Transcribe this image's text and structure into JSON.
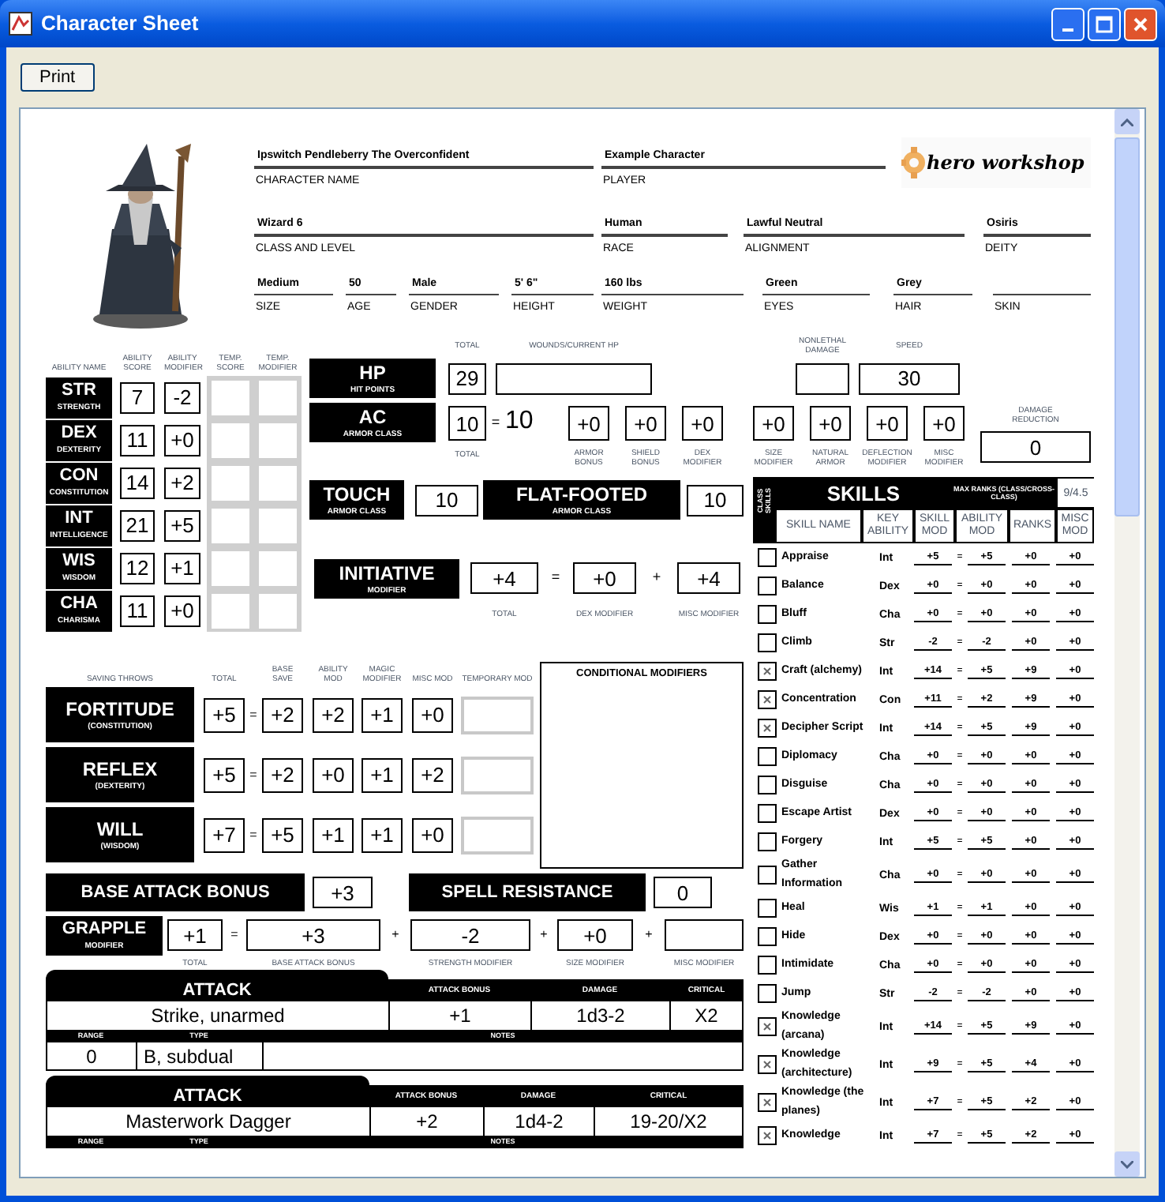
{
  "window": {
    "title": "Character Sheet"
  },
  "toolbar": {
    "buttons": [
      "Print"
    ]
  },
  "header": {
    "logo": "hero workshop",
    "fields": [
      {
        "value": "Ipswitch Pendleberry The Overconfident",
        "label": "CHARACTER NAME"
      },
      {
        "value": "Example Character",
        "label": "PLAYER"
      },
      {
        "value": "Wizard 6",
        "label": "CLASS AND LEVEL"
      },
      {
        "value": "Human",
        "label": "RACE"
      },
      {
        "value": "Lawful Neutral",
        "label": "ALIGNMENT"
      },
      {
        "value": "Osiris",
        "label": "DEITY"
      },
      {
        "value": "Medium",
        "label": "SIZE"
      },
      {
        "value": "50",
        "label": "AGE"
      },
      {
        "value": "Male",
        "label": "GENDER"
      },
      {
        "value": "5' 6\"",
        "label": "HEIGHT"
      },
      {
        "value": "160 lbs",
        "label": "WEIGHT"
      },
      {
        "value": "Green",
        "label": "EYES"
      },
      {
        "value": "Grey",
        "label": "HAIR"
      },
      {
        "label": "SKIN"
      }
    ]
  },
  "abilities": {
    "headers": [
      "ABILITY NAME",
      "ABILITY SCORE",
      "ABILITY MODIFIER",
      "TEMP. SCORE",
      "TEMP. MODIFIER"
    ],
    "rows": [
      {
        "abbr": "STR",
        "name": "STRENGTH",
        "score": "7",
        "modifier": "-2"
      },
      {
        "abbr": "DEX",
        "name": "DEXTERITY",
        "score": "11",
        "modifier": "+0"
      },
      {
        "abbr": "CON",
        "name": "CONSTITUTION",
        "score": "14",
        "modifier": "+2"
      },
      {
        "abbr": "INT",
        "name": "INTELLIGENCE",
        "score": "21",
        "modifier": "+5"
      },
      {
        "abbr": "WIS",
        "name": "WISDOM",
        "score": "12",
        "modifier": "+1"
      },
      {
        "abbr": "CHA",
        "name": "CHARISMA",
        "score": "11",
        "modifier": "+0"
      }
    ]
  },
  "hp": {
    "label": "HP",
    "sublabel": "HIT POINTS",
    "total_label": "TOTAL",
    "total": "29",
    "wounds_label": "WOUNDS/CURRENT HP",
    "nonlethal_label": "NONLETHAL DAMAGE",
    "speed_label": "SPEED",
    "speed": "30"
  },
  "ac": {
    "label": "AC",
    "sublabel": "ARMOR CLASS",
    "total": "10",
    "total_label": "TOTAL",
    "equals": "=",
    "base": "10",
    "components": [
      {
        "value": "+0",
        "label": "ARMOR BONUS"
      },
      {
        "value": "+0",
        "label": "SHIELD BONUS"
      },
      {
        "value": "+0",
        "label": "DEX MODIFIER"
      },
      {
        "value": "+0",
        "label": "SIZE MODIFIER"
      },
      {
        "value": "+0",
        "label": "NATURAL ARMOR"
      },
      {
        "value": "+0",
        "label": "DEFLECTION MODIFIER"
      },
      {
        "value": "+0",
        "label": "MISC MODIFIER"
      }
    ],
    "damage_reduction": {
      "label": "DAMAGE REDUCTION",
      "value": "0"
    }
  },
  "touch": {
    "label": "TOUCH",
    "sublabel": "ARMOR CLASS",
    "value": "10"
  },
  "flat_footed": {
    "label": "FLAT-FOOTED",
    "sublabel": "ARMOR CLASS",
    "value": "10"
  },
  "initiative": {
    "label": "INITIATIVE",
    "sublabel": "MODIFIER",
    "parts": [
      {
        "value": "+4",
        "label": "TOTAL"
      },
      {
        "op": "=",
        "value": "+0",
        "label": "DEX MODIFIER"
      },
      {
        "op": "+",
        "value": "+4",
        "label": "MISC MODIFIER"
      }
    ]
  },
  "saves": {
    "headers": [
      "SAVING THROWS",
      "TOTAL",
      "BASE SAVE",
      "ABILITY MOD",
      "MAGIC MODIFIER",
      "MISC MOD",
      "TEMPORARY MOD"
    ],
    "rows": [
      {
        "name": "FORTITUDE",
        "ability": "(CONSTITUTION)",
        "equals": "=",
        "values": [
          "+5",
          "+2",
          "+2",
          "+1",
          "+0"
        ]
      },
      {
        "name": "REFLEX",
        "ability": "(DEXTERITY)",
        "equals": "=",
        "values": [
          "+5",
          "+2",
          "+0",
          "+1",
          "+2"
        ]
      },
      {
        "name": "WILL",
        "ability": "(WISDOM)",
        "equals": "=",
        "values": [
          "+7",
          "+5",
          "+1",
          "+1",
          "+0"
        ]
      }
    ]
  },
  "conditional_modifiers": {
    "title": "CONDITIONAL MODIFIERS"
  },
  "base_attack_bonus": {
    "label": "BASE ATTACK BONUS",
    "value": "+3"
  },
  "spell_resistance": {
    "label": "SPELL RESISTANCE",
    "value": "0"
  },
  "grapple": {
    "label": "GRAPPLE",
    "sublabel": "MODIFIER",
    "parts": [
      {
        "value": "+1",
        "label": "TOTAL"
      },
      {
        "op": "=",
        "value": "+3",
        "label": "BASE ATTACK BONUS"
      },
      {
        "op": "+",
        "value": "-2",
        "label": "STRENGTH MODIFIER"
      },
      {
        "op": "+",
        "value": "+0",
        "label": "SIZE MODIFIER"
      },
      {
        "op": "+",
        "label": "MISC MODIFIER"
      }
    ]
  },
  "attacks": [
    {
      "title": "ATTACK",
      "headers": [
        "ATTACK BONUS",
        "DAMAGE",
        "CRITICAL"
      ],
      "name": "Strike, unarmed",
      "bonus": "+1",
      "damage": "1d3-2",
      "critical": "X2",
      "sub_headers": [
        "RANGE",
        "TYPE",
        "NOTES"
      ],
      "range": "0",
      "type": "B, subdual"
    },
    {
      "title": "ATTACK",
      "headers": [
        "ATTACK BONUS",
        "DAMAGE",
        "CRITICAL"
      ],
      "name": "Masterwork Dagger",
      "bonus": "+2",
      "damage": "1d4-2",
      "critical": "19-20/X2",
      "sub_headers": [
        "RANGE",
        "TYPE",
        "NOTES"
      ]
    }
  ],
  "skills": {
    "class_skills_label": "CLASS SKILLS",
    "title": "SKILLS",
    "max_ranks_label": "MAX RANKS (CLASS/CROSS-CLASS)",
    "max_ranks": "9/4.5",
    "columns": [
      "SKILL NAME",
      "KEY ABILITY",
      "SKILL MOD",
      "ABILITY MOD",
      "RANKS",
      "MISC MOD"
    ],
    "rows": [
      {
        "name": "Appraise",
        "class_skill": false,
        "key": "Int",
        "total": "+5",
        "equals": "=",
        "ability": "+5",
        "ranks": "+0",
        "misc": "+0"
      },
      {
        "name": "Balance",
        "class_skill": false,
        "key": "Dex",
        "total": "+0",
        "equals": "=",
        "ability": "+0",
        "ranks": "+0",
        "misc": "+0"
      },
      {
        "name": "Bluff",
        "class_skill": false,
        "key": "Cha",
        "total": "+0",
        "equals": "=",
        "ability": "+0",
        "ranks": "+0",
        "misc": "+0"
      },
      {
        "name": "Climb",
        "class_skill": false,
        "key": "Str",
        "total": "-2",
        "equals": "=",
        "ability": "-2",
        "ranks": "+0",
        "misc": "+0"
      },
      {
        "name": "Craft (alchemy)",
        "class_skill": true,
        "key": "Int",
        "total": "+14",
        "equals": "=",
        "ability": "+5",
        "ranks": "+9",
        "misc": "+0"
      },
      {
        "name": "Concentration",
        "class_skill": true,
        "key": "Con",
        "total": "+11",
        "equals": "=",
        "ability": "+2",
        "ranks": "+9",
        "misc": "+0"
      },
      {
        "name": "Decipher Script",
        "class_skill": true,
        "key": "Int",
        "total": "+14",
        "equals": "=",
        "ability": "+5",
        "ranks": "+9",
        "misc": "+0"
      },
      {
        "name": "Diplomacy",
        "class_skill": false,
        "key": "Cha",
        "total": "+0",
        "equals": "=",
        "ability": "+0",
        "ranks": "+0",
        "misc": "+0"
      },
      {
        "name": "Disguise",
        "class_skill": false,
        "key": "Cha",
        "total": "+0",
        "equals": "=",
        "ability": "+0",
        "ranks": "+0",
        "misc": "+0"
      },
      {
        "name": "Escape Artist",
        "class_skill": false,
        "key": "Dex",
        "total": "+0",
        "equals": "=",
        "ability": "+0",
        "ranks": "+0",
        "misc": "+0"
      },
      {
        "name": "Forgery",
        "class_skill": false,
        "key": "Int",
        "total": "+5",
        "equals": "=",
        "ability": "+5",
        "ranks": "+0",
        "misc": "+0"
      },
      {
        "name": "Gather Information",
        "class_skill": false,
        "key": "Cha",
        "total": "+0",
        "equals": "=",
        "ability": "+0",
        "ranks": "+0",
        "misc": "+0"
      },
      {
        "name": "Heal",
        "class_skill": false,
        "key": "Wis",
        "total": "+1",
        "equals": "=",
        "ability": "+1",
        "ranks": "+0",
        "misc": "+0"
      },
      {
        "name": "Hide",
        "class_skill": false,
        "key": "Dex",
        "total": "+0",
        "equals": "=",
        "ability": "+0",
        "ranks": "+0",
        "misc": "+0"
      },
      {
        "name": "Intimidate",
        "class_skill": false,
        "key": "Cha",
        "total": "+0",
        "equals": "=",
        "ability": "+0",
        "ranks": "+0",
        "misc": "+0"
      },
      {
        "name": "Jump",
        "class_skill": false,
        "key": "Str",
        "total": "-2",
        "equals": "=",
        "ability": "-2",
        "ranks": "+0",
        "misc": "+0"
      },
      {
        "name": "Knowledge (arcana)",
        "class_skill": true,
        "key": "Int",
        "total": "+14",
        "equals": "=",
        "ability": "+5",
        "ranks": "+9",
        "misc": "+0"
      },
      {
        "name": "Knowledge (architecture)",
        "class_skill": true,
        "key": "Int",
        "total": "+9",
        "equals": "=",
        "ability": "+5",
        "ranks": "+4",
        "misc": "+0"
      },
      {
        "name": "Knowledge (the planes)",
        "class_skill": true,
        "key": "Int",
        "total": "+7",
        "equals": "=",
        "ability": "+5",
        "ranks": "+2",
        "misc": "+0"
      },
      {
        "name": "Knowledge",
        "class_skill": true,
        "key": "Int",
        "total": "+7",
        "equals": "=",
        "ability": "+5",
        "ranks": "+2",
        "misc": "+0"
      }
    ]
  }
}
